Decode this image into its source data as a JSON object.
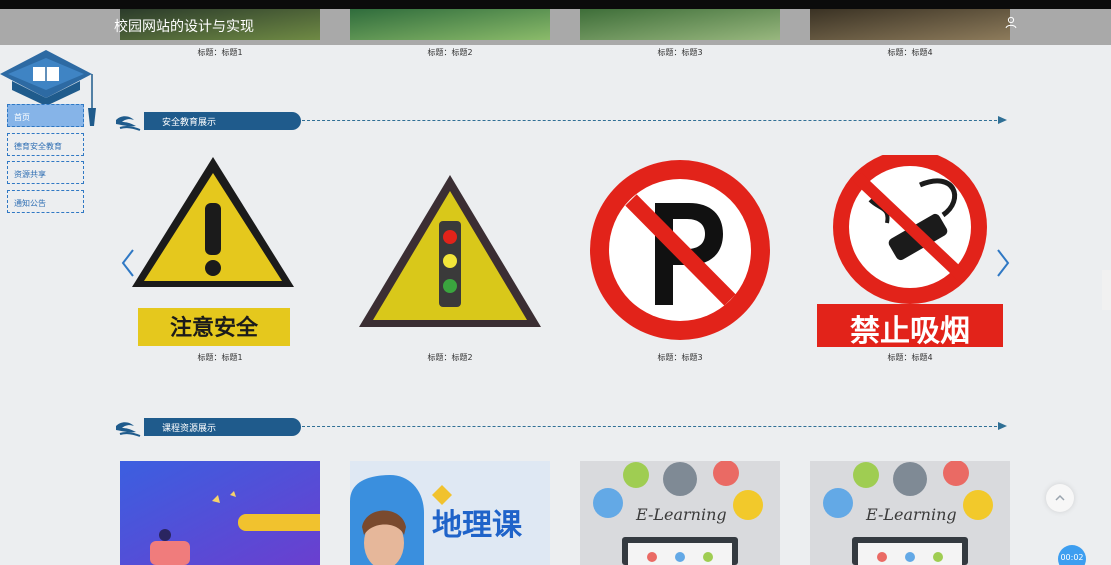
{
  "header": {
    "site_title": "校园网站的设计与实现",
    "top_captions": [
      "标题：标题1",
      "标题：标题2",
      "标题：标题3",
      "标题：标题4"
    ]
  },
  "sidebar": {
    "items": [
      {
        "label": "首页",
        "active": true
      },
      {
        "label": "德育安全教育",
        "active": false
      },
      {
        "label": "资源共享",
        "active": false
      },
      {
        "label": "通知公告",
        "active": false
      }
    ]
  },
  "safety": {
    "section_title": "安全教育展示",
    "sign_texts": [
      "注意安全",
      "禁止吸烟"
    ],
    "captions": [
      "标题：标题1",
      "标题：标题2",
      "标题：标题3",
      "标题：标题4"
    ]
  },
  "course": {
    "section_title": "课程资源展示",
    "banner_texts": [
      "地理课",
      "E-Learning",
      "E-Learning"
    ]
  },
  "widgets": {
    "timer": "00:02"
  },
  "colors": {
    "brand_blue": "#1f5b8c",
    "nav_border": "#2f78c4",
    "nav_active": "#86b4e8",
    "sign_yellow": "#e5c81d",
    "sign_red": "#e2231a"
  }
}
